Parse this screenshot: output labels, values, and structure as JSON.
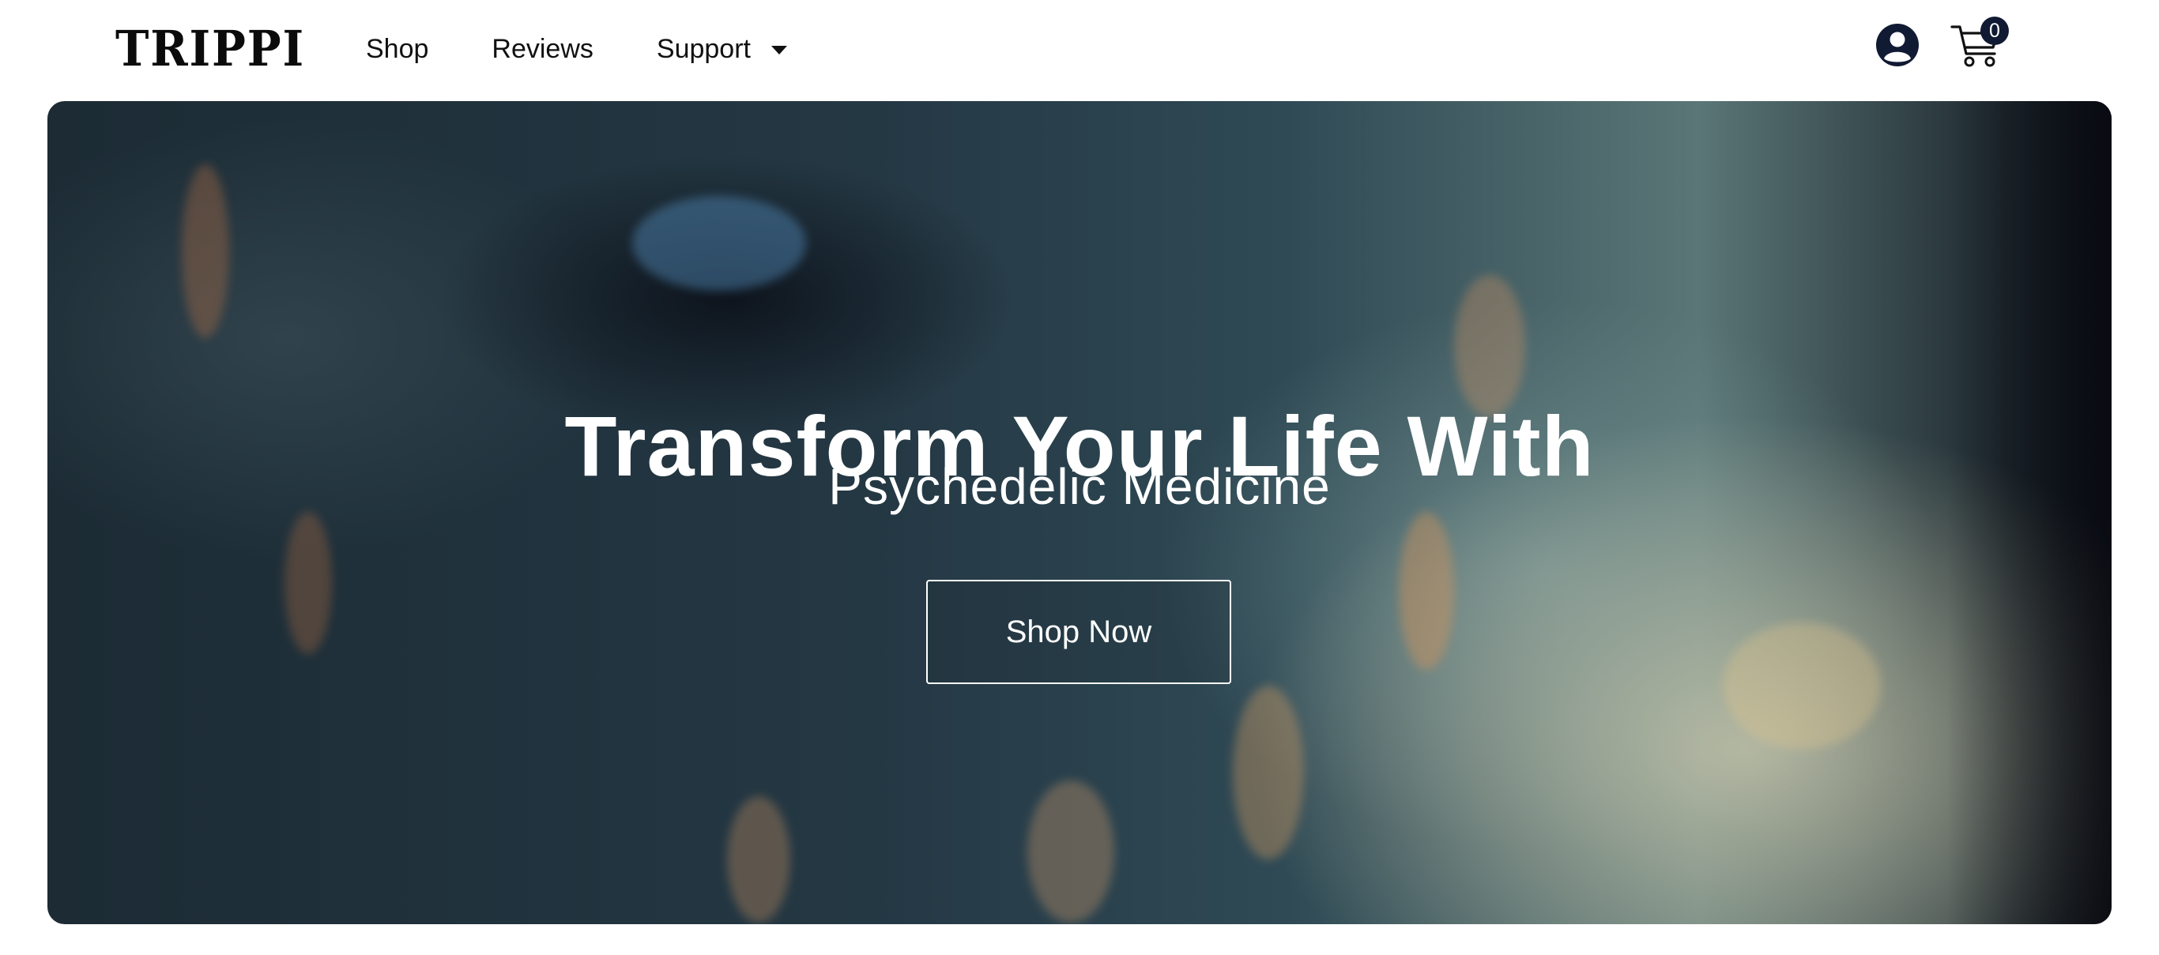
{
  "header": {
    "logo": "TRIPPI",
    "nav": [
      {
        "label": "Shop"
      },
      {
        "label": "Reviews"
      },
      {
        "label": "Support"
      }
    ],
    "account_icon": "account-circle-icon",
    "cart_icon": "shopping-cart-icon",
    "cart_count": "0"
  },
  "hero": {
    "title": "Transform Your Life With",
    "subtitle": "Psychedelic Medicine",
    "cta_label": "Shop Now"
  },
  "colors": {
    "text_dark": "#111111",
    "badge_bg": "#111a33",
    "hero_text": "#ffffff"
  }
}
